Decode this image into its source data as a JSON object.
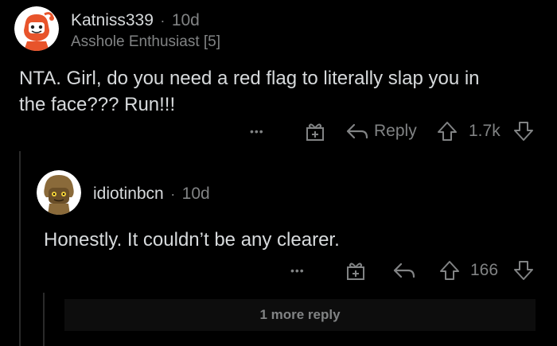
{
  "comment1": {
    "username": "Katniss339",
    "separator": "·",
    "age": "10d",
    "flair": "Asshole Enthusiast [5]",
    "body_line1": "NTA. Girl, do you need a red flag to literally slap you in",
    "body_line2": "the face??? Run!!!",
    "actions": {
      "more": "•••",
      "reply_label": "Reply",
      "score": "1.7k"
    }
  },
  "comment2": {
    "username": "idiotinbcn",
    "separator": "·",
    "age": "10d",
    "body": "Honestly. It couldn’t be any clearer.",
    "actions": {
      "more": "•••",
      "score": "166"
    }
  },
  "more_replies": {
    "label": "1 more reply"
  },
  "colors": {
    "background": "#000000",
    "text": "#d7dadc",
    "muted": "#818384",
    "avatar1_accent": "#e8542b",
    "avatar2_accent": "#8a6a3a"
  }
}
